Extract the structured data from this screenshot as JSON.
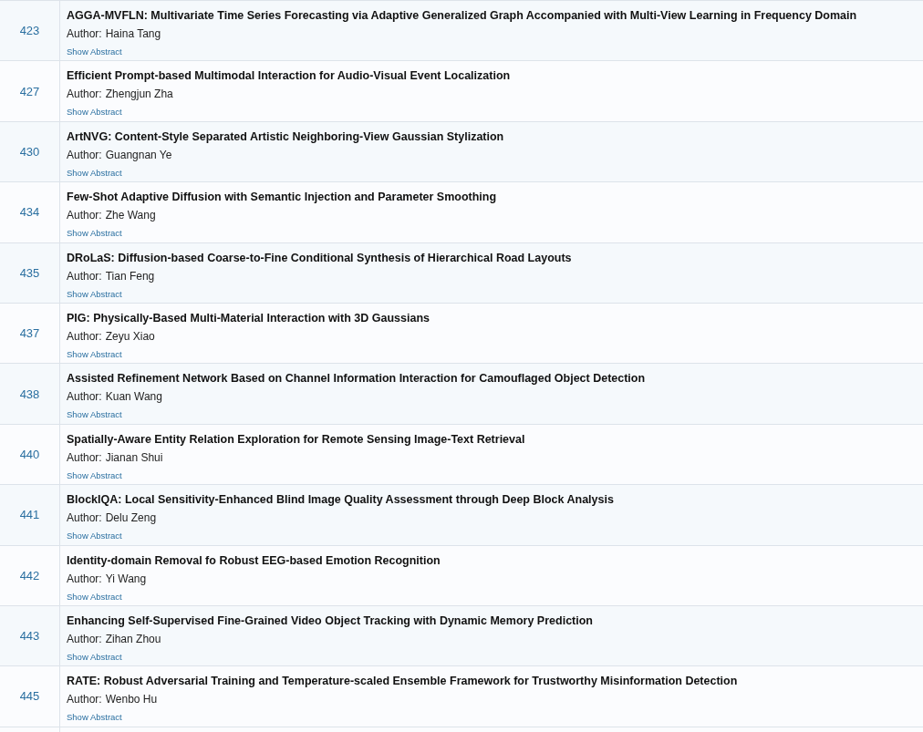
{
  "papers": [
    {
      "number": "423",
      "title": "AGGA-MVFLN: Multivariate Time Series Forecasting via Adaptive Generalized Graph Accompanied with Multi-View Learning in Frequency Domain",
      "author_label": "Author:",
      "author": "Haina Tang",
      "abstract_link": "Show Abstract"
    },
    {
      "number": "427",
      "title": "Efficient Prompt-based Multimodal Interaction for Audio-Visual Event Localization",
      "author_label": "Author:",
      "author": "Zhengjun Zha",
      "abstract_link": "Show Abstract"
    },
    {
      "number": "430",
      "title": "ArtNVG: Content-Style Separated Artistic Neighboring-View Gaussian Stylization",
      "author_label": "Author:",
      "author": "Guangnan Ye",
      "abstract_link": "Show Abstract"
    },
    {
      "number": "434",
      "title": "Few-Shot Adaptive Diffusion with Semantic Injection and Parameter Smoothing",
      "author_label": "Author:",
      "author": "Zhe Wang",
      "abstract_link": "Show Abstract"
    },
    {
      "number": "435",
      "title": "DRoLaS: Diffusion-based Coarse-to-Fine Conditional Synthesis of Hierarchical Road Layouts",
      "author_label": "Author:",
      "author": "Tian Feng",
      "abstract_link": "Show Abstract"
    },
    {
      "number": "437",
      "title": "PIG: Physically-Based Multi-Material Interaction with 3D Gaussians",
      "author_label": "Author:",
      "author": "Zeyu Xiao",
      "abstract_link": "Show Abstract"
    },
    {
      "number": "438",
      "title": "Assisted Refinement Network Based on Channel Information Interaction for Camouflaged Object Detection",
      "author_label": "Author:",
      "author": "Kuan Wang",
      "abstract_link": "Show Abstract"
    },
    {
      "number": "440",
      "title": "Spatially-Aware Entity Relation Exploration for Remote Sensing Image-Text Retrieval",
      "author_label": "Author:",
      "author": "Jianan Shui",
      "abstract_link": "Show Abstract"
    },
    {
      "number": "441",
      "title": "BlockIQA: Local Sensitivity-Enhanced Blind Image Quality Assessment through Deep Block Analysis",
      "author_label": "Author:",
      "author": "Delu Zeng",
      "abstract_link": "Show Abstract"
    },
    {
      "number": "442",
      "title": "Identity-domain Removal fo Robust EEG-based Emotion Recognition",
      "author_label": "Author:",
      "author": "Yi Wang",
      "abstract_link": "Show Abstract"
    },
    {
      "number": "443",
      "title": "Enhancing Self-Supervised Fine-Grained Video Object Tracking with Dynamic Memory Prediction",
      "author_label": "Author:",
      "author": "Zihan Zhou",
      "abstract_link": "Show Abstract"
    },
    {
      "number": "445",
      "title": "RATE: Robust Adversarial Training and Temperature-scaled Ensemble Framework for Trustworthy Misinformation Detection",
      "author_label": "Author:",
      "author": "Wenbo Hu",
      "abstract_link": "Show Abstract"
    }
  ]
}
